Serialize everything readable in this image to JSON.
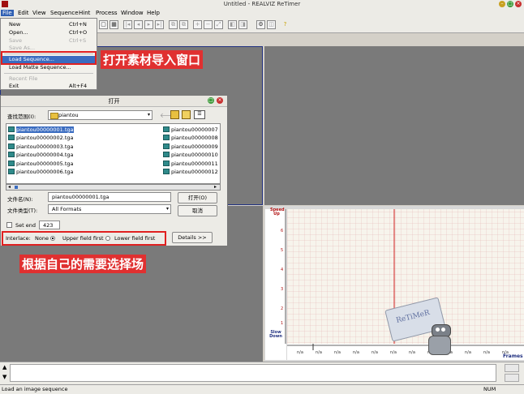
{
  "window": {
    "title": "Untitled - REALVIZ ReTimer"
  },
  "menubar": [
    "File",
    "Edit",
    "View",
    "Sequence",
    "Hint",
    "Process",
    "Window",
    "Help"
  ],
  "file_menu": {
    "items": [
      {
        "label": "New",
        "shortcut": "Ctrl+N",
        "state": "normal"
      },
      {
        "label": "Open...",
        "shortcut": "Ctrl+O",
        "state": "normal"
      },
      {
        "label": "Save",
        "shortcut": "Ctrl+S",
        "state": "disabled"
      },
      {
        "label": "Save As...",
        "shortcut": "",
        "state": "disabled"
      },
      {
        "label": "Load Sequence...",
        "shortcut": "",
        "state": "selected"
      },
      {
        "label": "Load Matte Sequence...",
        "shortcut": "",
        "state": "normal"
      },
      {
        "label": "Recent File",
        "shortcut": "",
        "state": "disabled"
      },
      {
        "label": "Exit",
        "shortcut": "Alt+F4",
        "state": "normal"
      }
    ]
  },
  "annotations": {
    "open_window": "打开素材导入窗口",
    "choose_field": "根据自己的需要选择场"
  },
  "dialog": {
    "title": "打开",
    "look_in_label": "查找范围(I):",
    "look_in_value": "piantou",
    "files_left": [
      "piantou00000001.tga",
      "piantou00000002.tga",
      "piantou00000003.tga",
      "piantou00000004.tga",
      "piantou00000005.tga",
      "piantou00000006.tga"
    ],
    "files_right": [
      "piantou00000007",
      "piantou00000008",
      "piantou00000009",
      "piantou00000010",
      "piantou00000011",
      "piantou00000012"
    ],
    "filename_label": "文件名(N):",
    "filename_value": "piantou00000001.tga",
    "filetype_label": "文件类型(T):",
    "filetype_value": "All Formats",
    "open_button": "打开(O)",
    "cancel_button": "取消",
    "set_end_label": "Set end",
    "set_end_value": "423",
    "interlace_label": "Interlace:",
    "interlace_options": [
      "None",
      "Upper field first",
      "Lower field first"
    ],
    "interlace_selected": "None",
    "details_button": "Details >>"
  },
  "graph": {
    "speed_up": "Speed Up",
    "slow_down": "Slow Down",
    "y_ticks": [
      "6",
      "5",
      "4",
      "3",
      "2",
      "1"
    ],
    "x_ticks": [
      "n/a",
      "n/a",
      "n/a",
      "n/a",
      "n/a",
      "n/a",
      "n/a",
      "n/a",
      "n/a",
      "n/a",
      "n/a",
      "n/a"
    ],
    "frames_label": "Frames",
    "mascot_text": "ReTiMeR"
  },
  "status": {
    "message": "Load an image sequence",
    "num": "NUM"
  }
}
